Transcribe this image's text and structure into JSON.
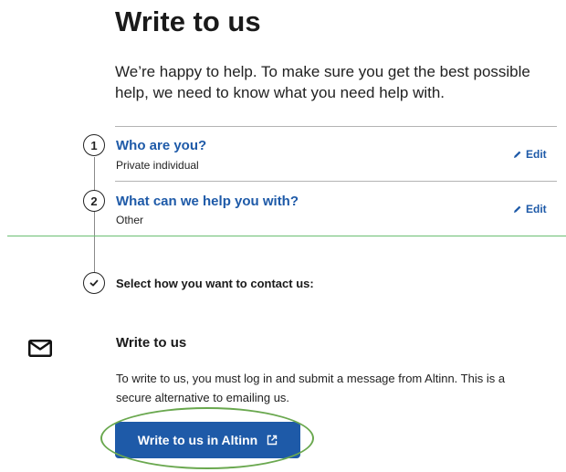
{
  "page": {
    "title": "Write to us",
    "intro": "We’re happy to help. To make sure you get the best possible help, we need to know what you need help with."
  },
  "steps": [
    {
      "number": "1",
      "title": "Who are you?",
      "answer": "Private individual",
      "edit_label": "Edit"
    },
    {
      "number": "2",
      "title": "What can we help you with?",
      "answer": "Other",
      "edit_label": "Edit"
    }
  ],
  "contact_step": {
    "prompt": "Select how you want to contact us:"
  },
  "write_section": {
    "title": "Write to us",
    "description": "To write to us, you must log in and submit a message from Altinn. This is a secure alternative to emailing us.",
    "button_label": "Write to us in Altinn",
    "icon": "envelope-icon",
    "button_icon": "external-link-icon"
  },
  "colors": {
    "link": "#1e5aa8",
    "button_bg": "#1e5aa8",
    "highlight": "#6aa84f",
    "divider_green": "#6bbf73"
  }
}
